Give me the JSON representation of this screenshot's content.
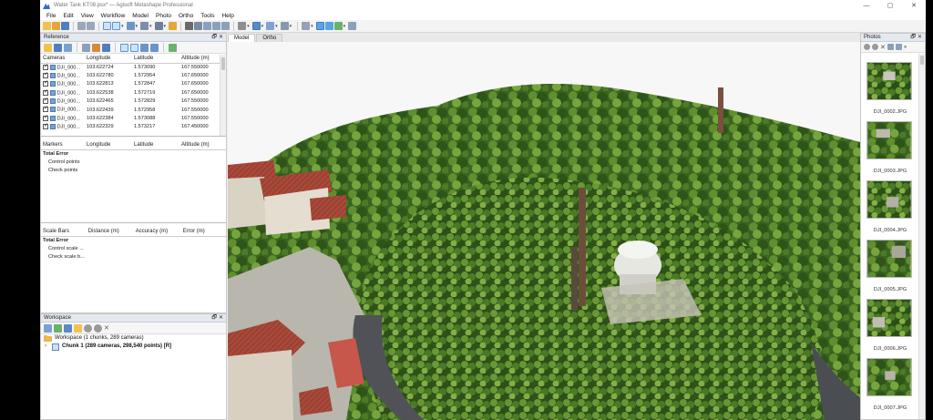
{
  "window": {
    "title": "Water Tank KT08.psx* — Agisoft Metashape Professional",
    "controls": [
      "—",
      "▢",
      "✕"
    ]
  },
  "menu": [
    "File",
    "Edit",
    "View",
    "Workflow",
    "Model",
    "Photo",
    "Ortho",
    "Tools",
    "Help"
  ],
  "colors": {
    "accent": "#3c79c9",
    "panel_title_bg": "#e4e8ef",
    "selected_tool": "#cfe3f7"
  },
  "reference": {
    "title": "Reference",
    "cameras": {
      "headers": [
        "Cameras",
        "Longitude",
        "Latitude",
        "Altitude (m)"
      ],
      "rows": [
        [
          "DJI_000...",
          "103.622724",
          "1.573090",
          "167.550000"
        ],
        [
          "DJI_000...",
          "103.622780",
          "1.572954",
          "167.650000"
        ],
        [
          "DJI_000...",
          "103.622813",
          "1.572847",
          "167.650000"
        ],
        [
          "DJI_000...",
          "103.622538",
          "1.572719",
          "167.650000"
        ],
        [
          "DJI_000...",
          "103.622465",
          "1.572829",
          "167.550000"
        ],
        [
          "DJI_000...",
          "103.622439",
          "1.572958",
          "167.550000"
        ],
        [
          "DJI_000...",
          "103.622384",
          "1.573088",
          "167.550000"
        ],
        [
          "DJI_000...",
          "103.622329",
          "1.573217",
          "167.450000"
        ]
      ]
    },
    "markers": {
      "headers": [
        "Markers",
        "Longitude",
        "Latitude",
        "Altitude (m)"
      ],
      "total_error": "Total Error",
      "rows": [
        "Control points",
        "Check points"
      ]
    },
    "scalebars": {
      "headers": [
        "Scale Bars",
        "Distance (m)",
        "Accuracy (m)",
        "Error (m)"
      ],
      "total_error": "Total Error",
      "rows": [
        "Control scale ...",
        "Check scale b..."
      ]
    }
  },
  "workspace": {
    "title": "Workspace",
    "root": "Workspace (1 chunks, 289 cameras)",
    "chunk": "Chunk 1 (289 cameras, 298,540 points) [R]"
  },
  "viewport": {
    "tabs": [
      "Model",
      "Ortho"
    ],
    "active_tab": "Model"
  },
  "photos": {
    "title": "Photos",
    "items": [
      "DJI_0002.JPG",
      "DJI_0003.JPG",
      "DJI_0004.JPG",
      "DJI_0005.JPG",
      "DJI_0006.JPG",
      "DJI_0007.JPG"
    ]
  }
}
